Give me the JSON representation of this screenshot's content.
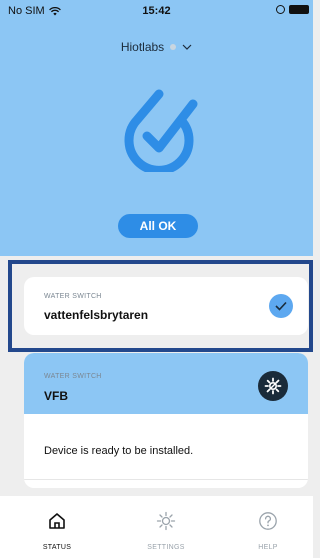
{
  "status_bar": {
    "carrier": "No SIM",
    "time": "15:42"
  },
  "header": {
    "account": "Hiotlabs"
  },
  "hero": {
    "status_button": "All OK"
  },
  "devices": [
    {
      "type": "WATER SWITCH",
      "name": "vattenfelsbrytaren",
      "state_icon": "check-icon"
    },
    {
      "type": "WATER SWITCH",
      "name": "VFB",
      "state_icon": "gear-icon",
      "message": "Device is ready to be installed."
    }
  ],
  "tabs": [
    {
      "label": "STATUS",
      "icon": "home-icon",
      "active": true
    },
    {
      "label": "SETTINGS",
      "icon": "gear-icon",
      "active": false
    },
    {
      "label": "HELP",
      "icon": "help-icon",
      "active": false
    }
  ],
  "colors": {
    "hero_bg": "#8cc6f4",
    "accent": "#2e8de6",
    "highlight_border": "#23488c",
    "gear_bg": "#1a2b3a"
  }
}
